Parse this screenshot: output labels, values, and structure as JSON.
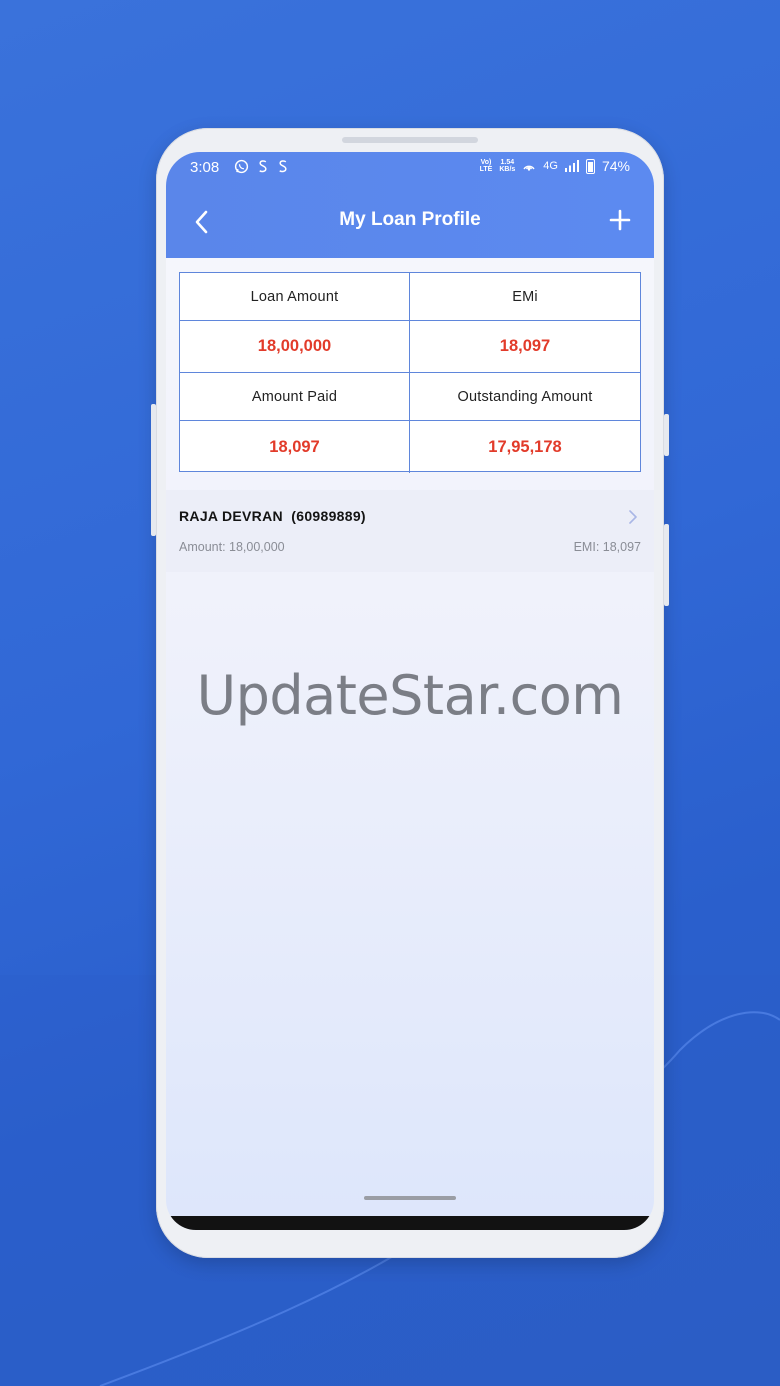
{
  "status_bar": {
    "time": "3:08",
    "volte_top": "Vo)",
    "volte_bottom": "LTE",
    "speed_value": "1.54",
    "speed_unit": "KB/s",
    "network": "4G",
    "battery": "74%"
  },
  "toolbar": {
    "title": "My Loan Profile"
  },
  "summary": {
    "loan_amount_label": "Loan Amount",
    "loan_amount_value": "18,00,000",
    "emi_label": "EMi",
    "emi_value": "18,097",
    "amount_paid_label": "Amount Paid",
    "amount_paid_value": "18,097",
    "outstanding_label": "Outstanding Amount",
    "outstanding_value": "17,95,178"
  },
  "loans": [
    {
      "name": "RAJA DEVRAN  (60989889)",
      "amount": "Amount: 18,00,000",
      "emi": "EMI: 18,097"
    }
  ],
  "watermark": "UpdateStar.com",
  "colors": {
    "header": "#5c8af0",
    "value_red": "#e23b2a",
    "table_border": "#5f86db"
  }
}
